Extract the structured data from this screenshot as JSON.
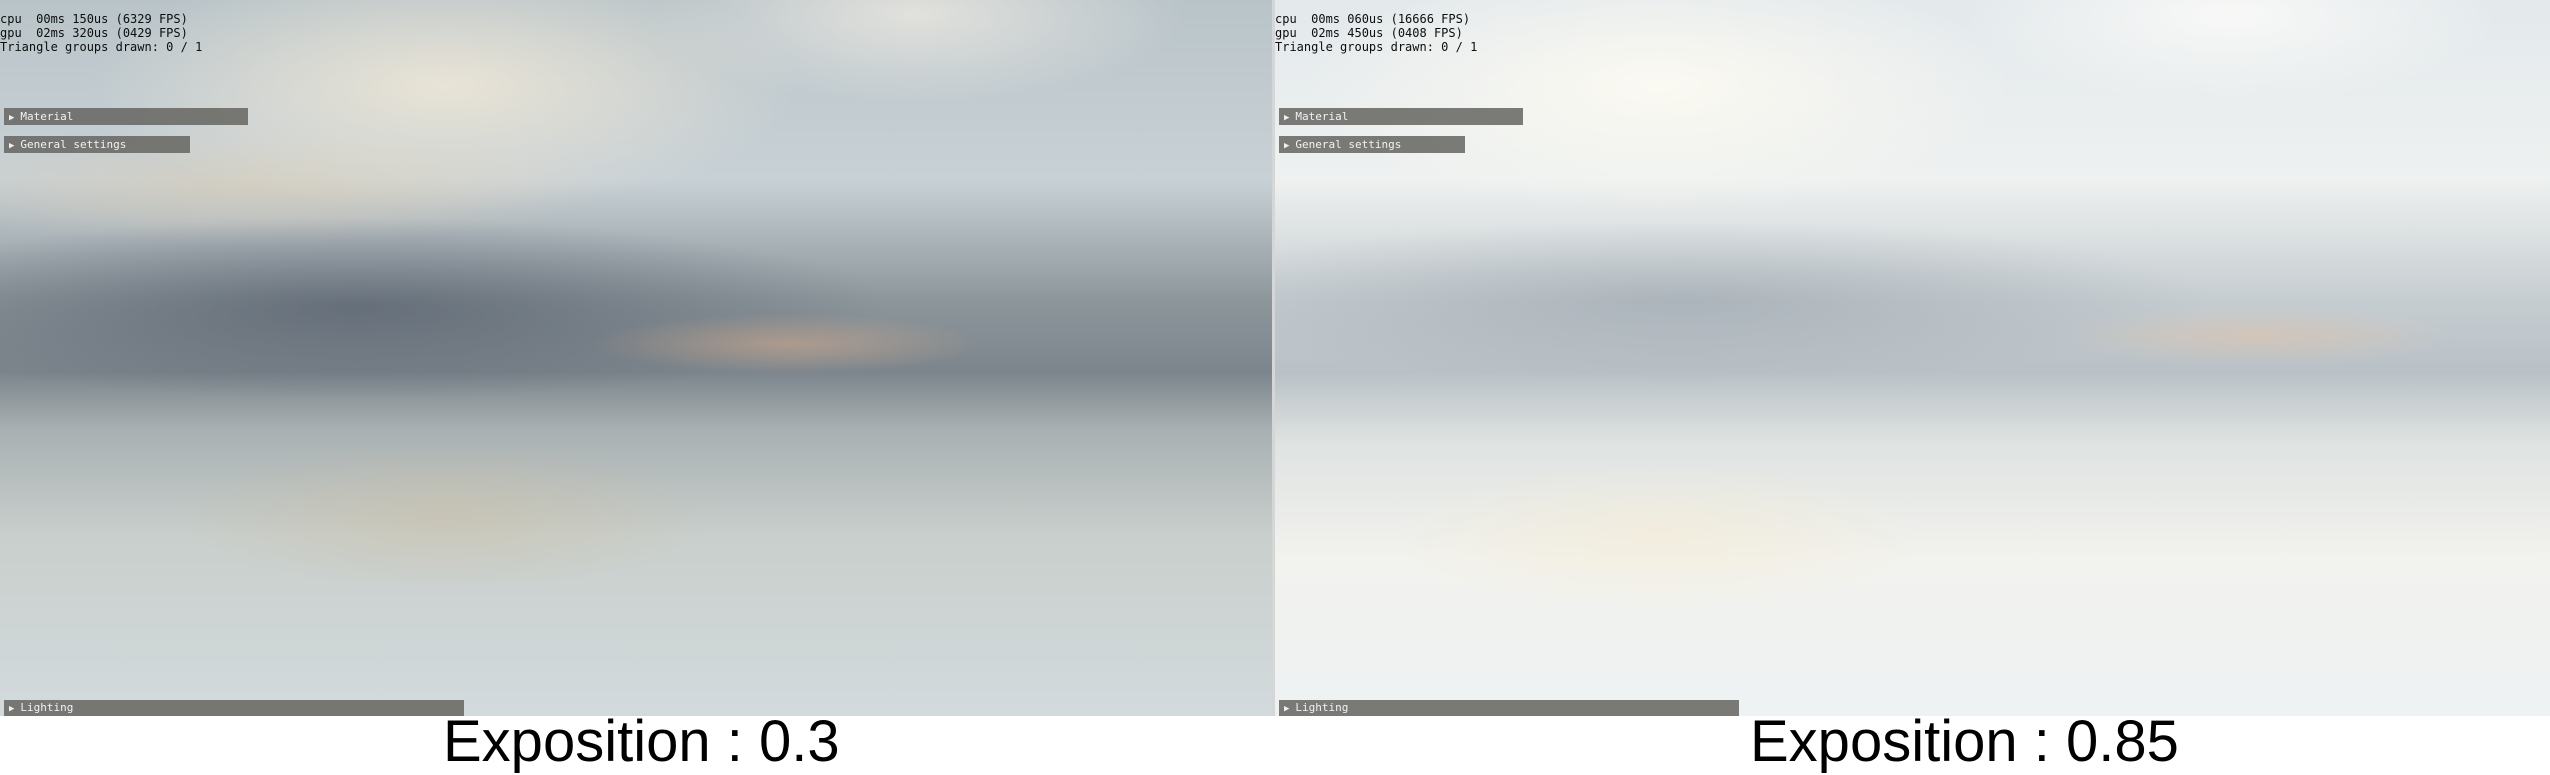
{
  "left": {
    "stats": [
      "cpu  00ms 150us (6329 FPS)",
      "gpu  02ms 320us (0429 FPS)",
      "Triangle groups drawn: 0 / 1"
    ],
    "panels": {
      "material": "Material",
      "general": "General settings",
      "lighting": "Lighting"
    },
    "caption": "Exposition : 0.3"
  },
  "right": {
    "stats": [
      "cpu  00ms 060us (16666 FPS)",
      "gpu  02ms 450us (0408 FPS)",
      "Triangle groups drawn: 0 / 1"
    ],
    "panels": {
      "material": "Material",
      "general": "General settings",
      "lighting": "Lighting"
    },
    "caption": "Exposition : 0.85"
  },
  "icons": {
    "expand": "triangle-right-icon"
  }
}
